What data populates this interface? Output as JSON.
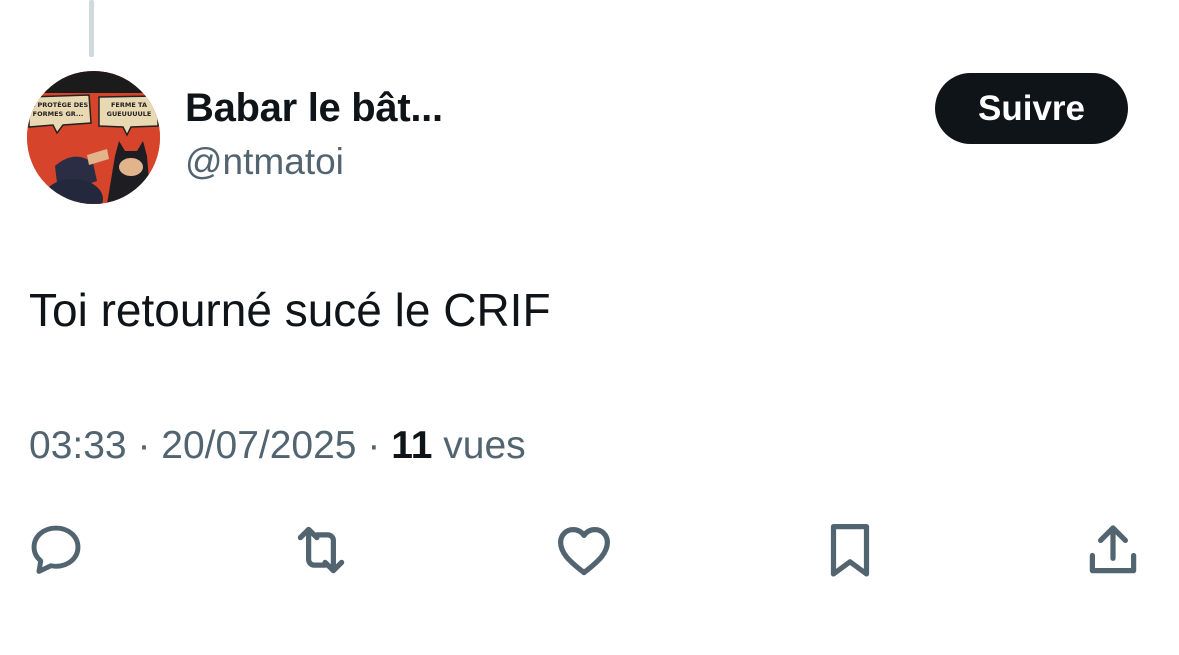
{
  "author": {
    "display_name": "Babar le bât...",
    "handle": "@ntmatoi",
    "avatar_caption_left": "JA PROTÈGE DES FORMES GR...",
    "avatar_caption_right": "FERME TA GUEUUUUUULE"
  },
  "follow_button": {
    "label": "Suivre"
  },
  "tweet": {
    "text": "Toi retourné sucé le CRIF",
    "time": "03:33",
    "separator": "·",
    "date": "20/07/2025",
    "views_count": "11",
    "views_label": "vues"
  },
  "actions": [
    {
      "icon": "reply-icon"
    },
    {
      "icon": "retweet-icon"
    },
    {
      "icon": "like-icon"
    },
    {
      "icon": "bookmark-icon"
    },
    {
      "icon": "share-icon"
    }
  ],
  "colors": {
    "text_primary": "#0f1419",
    "text_secondary": "#536471",
    "button_bg": "#0f1419",
    "thread_line": "#cfd9de"
  }
}
